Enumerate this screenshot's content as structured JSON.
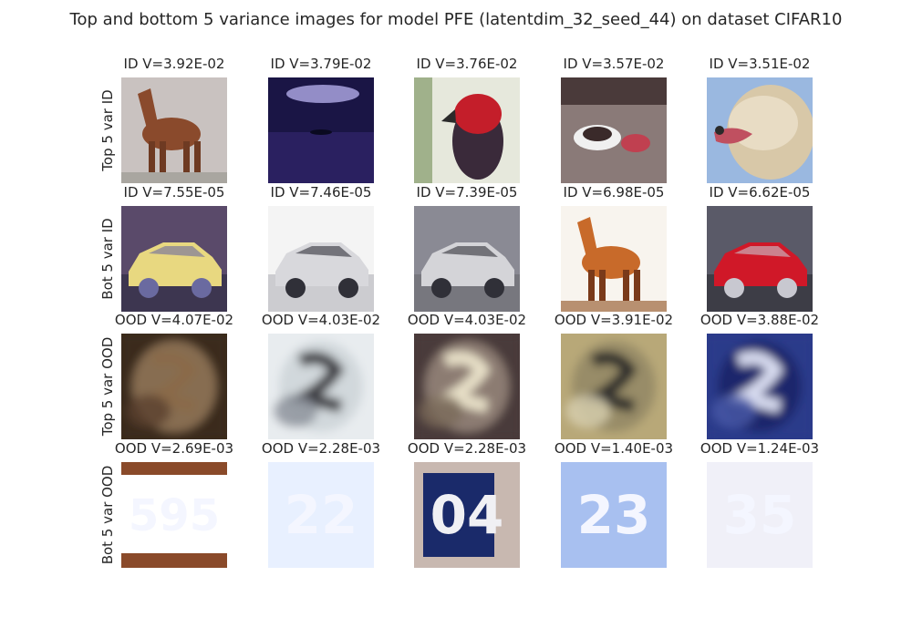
{
  "figure": {
    "title": "Top and bottom 5 variance images for model PFE (latentdim_32_seed_44) on dataset CIFAR10"
  },
  "chart_data": {
    "type": "image_grid",
    "title": "Top and bottom 5 variance images for model PFE (latentdim_32_seed_44) on dataset CIFAR10",
    "rows": [
      {
        "label": "Top 5 var ID",
        "cells": [
          {
            "label": "ID V=3.92E-02",
            "variance": 0.0392,
            "content": "brown horse",
            "colors": [
              "#c9c2c0",
              "#8a4a2c",
              "#6e3a22",
              "#a9a6a0"
            ]
          },
          {
            "label": "ID V=3.79E-02",
            "variance": 0.0379,
            "content": "purple sky over water",
            "colors": [
              "#6a4fc8",
              "#1a1545",
              "#2a2060",
              "#c8c0ff"
            ]
          },
          {
            "label": "ID V=3.76E-02",
            "variance": 0.0376,
            "content": "red parrot",
            "colors": [
              "#e6e8dc",
              "#c41e2a",
              "#3a2a3a",
              "#5a7a3a"
            ]
          },
          {
            "label": "ID V=3.57E-02",
            "variance": 0.0357,
            "content": "animal lying on ground",
            "colors": [
              "#8a7a78",
              "#3a2a2a",
              "#f0f0f0",
              "#c04050"
            ]
          },
          {
            "label": "ID V=3.51E-02",
            "variance": 0.0351,
            "content": "golden dog head",
            "colors": [
              "#9ab8e0",
              "#d8c8a8",
              "#e8dcc4",
              "#c05060"
            ]
          }
        ]
      },
      {
        "label": "Bot 5 var ID",
        "cells": [
          {
            "label": "ID V=7.55E-05",
            "variance": 7.55e-05,
            "content": "yellow car",
            "colors": [
              "#5a4a6a",
              "#e8d880",
              "#6a6aa0",
              "#2a2a40"
            ]
          },
          {
            "label": "ID V=7.46E-05",
            "variance": 7.46e-05,
            "content": "white car",
            "colors": [
              "#f4f4f4",
              "#d8d8dc",
              "#303038",
              "#b0b0b8"
            ]
          },
          {
            "label": "ID V=7.39E-05",
            "variance": 7.39e-05,
            "content": "silver car",
            "colors": [
              "#8a8a94",
              "#d4d4d8",
              "#303038",
              "#6a6a70"
            ]
          },
          {
            "label": "ID V=6.98E-05",
            "variance": 6.98e-05,
            "content": "brown horse",
            "colors": [
              "#f8f4ee",
              "#c86a2a",
              "#7a3a1a",
              "#b89070"
            ]
          },
          {
            "label": "ID V=6.62E-05",
            "variance": 6.62e-05,
            "content": "red car",
            "colors": [
              "#5a5a68",
              "#d01828",
              "#c8c8d0",
              "#2a2a30"
            ]
          }
        ]
      },
      {
        "label": "Top 5 var OOD",
        "cells": [
          {
            "label": "OOD V=4.07E-02",
            "variance": 0.0407,
            "content": "blurry dark digit",
            "colors": [
              "#3a2a1a",
              "#8a6a4a",
              "#5a4030",
              "#a88a6a"
            ]
          },
          {
            "label": "OOD V=4.03E-02",
            "variance": 0.0403,
            "content": "blurry digit",
            "colors": [
              "#e8ecef",
              "#3a3a40",
              "#8a9098",
              "#c8d0d4"
            ]
          },
          {
            "label": "OOD V=4.03E-02",
            "variance": 0.0403,
            "content": "blurry digit",
            "colors": [
              "#4a3a3a",
              "#e8e0c8",
              "#7a6a5a",
              "#a8988a"
            ]
          },
          {
            "label": "OOD V=3.91E-02",
            "variance": 0.0391,
            "content": "circular sign with digits",
            "colors": [
              "#b8a878",
              "#2a2a2a",
              "#d8d0b0",
              "#8a8060"
            ]
          },
          {
            "label": "OOD V=3.88E-02",
            "variance": 0.0388,
            "content": "blurry blue digit",
            "colors": [
              "#2a3a8a",
              "#d8dcf0",
              "#4a5aa8",
              "#1a2060"
            ]
          }
        ]
      },
      {
        "label": "Bot 5 var OOD",
        "cells": [
          {
            "label": "OOD V=2.69E-03",
            "variance": 0.00269,
            "content": "house number",
            "digits": "595",
            "colors": [
              "#1e2a8a",
              "#ffffff",
              "#8a4a2a",
              "#f0f0f0"
            ]
          },
          {
            "label": "OOD V=2.28E-03",
            "variance": 0.00228,
            "content": "house number",
            "digits": "22",
            "colors": [
              "#1a3aa8",
              "#e8f0ff",
              "#2a4ab8",
              "#ffffff"
            ]
          },
          {
            "label": "OOD V=2.28E-03",
            "variance": 0.00228,
            "content": "house number",
            "digits": "04",
            "colors": [
              "#c8b8b0",
              "#1a2a6a",
              "#f0f0f4",
              "#a89890"
            ]
          },
          {
            "label": "OOD V=1.40E-03",
            "variance": 0.0014,
            "content": "house number",
            "digits": "23",
            "colors": [
              "#3a6ad0",
              "#a8c0f0",
              "#5a8ae0",
              "#2a4aa8"
            ]
          },
          {
            "label": "OOD V=1.24E-03",
            "variance": 0.00124,
            "content": "house number",
            "digits": "35",
            "colors": [
              "#2a3a7a",
              "#f0f0f8",
              "#4a5a98",
              "#1a2050"
            ]
          }
        ]
      }
    ]
  }
}
